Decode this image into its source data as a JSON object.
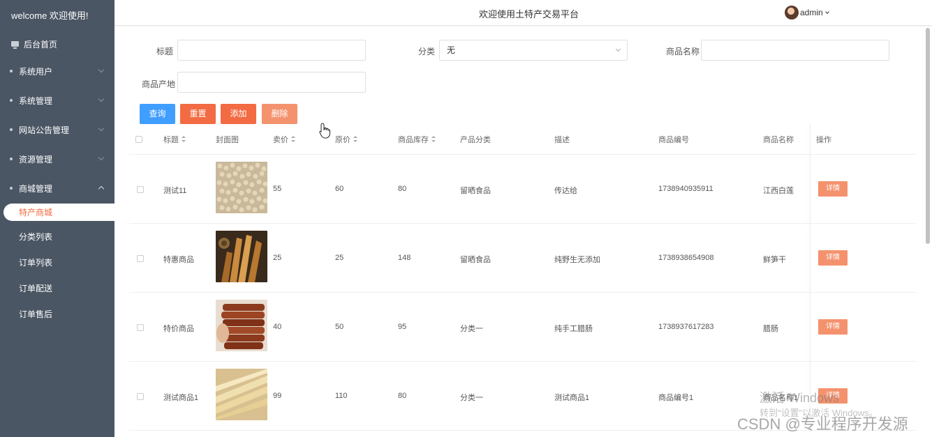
{
  "sidebar": {
    "welcome": "welcome 欢迎使用!",
    "home": "后台首页",
    "menus": [
      {
        "label": "系统用户",
        "expanded": false
      },
      {
        "label": "系统管理",
        "expanded": false
      },
      {
        "label": "网站公告管理",
        "expanded": false
      },
      {
        "label": "资源管理",
        "expanded": false
      },
      {
        "label": "商城管理",
        "expanded": true
      }
    ],
    "sub_items": [
      "特产商城",
      "分类列表",
      "订单列表",
      "订单配送",
      "订单售后"
    ]
  },
  "header": {
    "title": "欢迎使用土特产交易平台",
    "username": "admin"
  },
  "search": {
    "title_label": "标题",
    "title_value": "",
    "category_label": "分类",
    "category_value": "无",
    "name_label": "商品名称",
    "name_value": "",
    "origin_label": "商品产地",
    "origin_value": ""
  },
  "buttons": {
    "query": "查询",
    "reset": "重置",
    "add": "添加",
    "delete": "删除"
  },
  "colors": {
    "sidebar_bg": "#4b5664",
    "query_btn": "#409eff",
    "reset_btn": "#f26b42",
    "add_btn": "#f26b42",
    "delete_btn": "#f4926e",
    "active_text": "#f26b42"
  },
  "table": {
    "headers": [
      "标题",
      "封面图",
      "卖价",
      "原价",
      "商品库存",
      "产品分类",
      "描述",
      "商品编号",
      "商品名称",
      "操作"
    ],
    "detail_label": "详情",
    "rows": [
      {
        "title": "测试11",
        "image": "soybean-image",
        "price": "55",
        "original": "60",
        "stock": "80",
        "category": "留晒食品",
        "desc": "传达给",
        "code": "1738940935911",
        "name": "江西白莲"
      },
      {
        "title": "特惠商品",
        "image": "dried-bamboo-image",
        "price": "25",
        "original": "25",
        "stock": "148",
        "category": "留晒食品",
        "desc": "纯野生无添加",
        "code": "1738938654908",
        "name": "鲜笋干"
      },
      {
        "title": "特价商品",
        "image": "sausage-image",
        "price": "40",
        "original": "50",
        "stock": "95",
        "category": "分类一",
        "desc": "纯手工腊肠",
        "code": "1738937617283",
        "name": "腊肠"
      },
      {
        "title": "测试商品1",
        "image": "rice-noodle-image",
        "price": "99",
        "original": "110",
        "stock": "80",
        "category": "分类一",
        "desc": "测试商品1",
        "code": "商品编号1",
        "name": "商品名称1"
      }
    ]
  },
  "watermark": {
    "activate": "激活 Windows",
    "activate_hint": "转到\"设置\"以激活 Windows。",
    "csdn": "CSDN @专业程序开发源"
  }
}
